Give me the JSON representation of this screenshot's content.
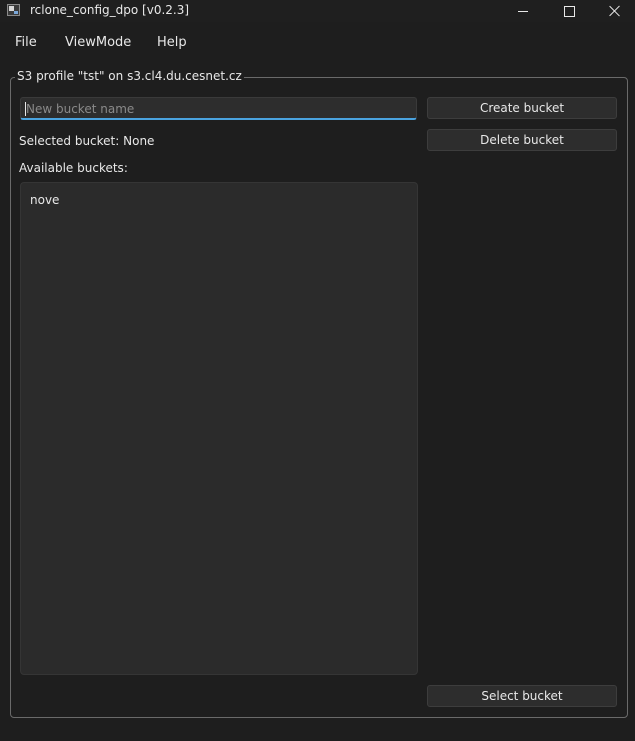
{
  "window": {
    "title": "rclone_config_dpo [v0.2.3]"
  },
  "menu": {
    "file": "File",
    "viewmode": "ViewMode",
    "help": "Help"
  },
  "group": {
    "title": "S3 profile \"tst\" on s3.cl4.du.cesnet.cz"
  },
  "new_bucket": {
    "placeholder": "New bucket name",
    "value": ""
  },
  "buttons": {
    "create": "Create bucket",
    "delete": "Delete bucket",
    "select": "Select bucket"
  },
  "selected_bucket_text": "Selected bucket: None",
  "available_buckets_label": "Available buckets:",
  "buckets": [
    "nove"
  ],
  "colors": {
    "background": "#1e1e1e",
    "input_focus_accent": "#4aa3df"
  }
}
